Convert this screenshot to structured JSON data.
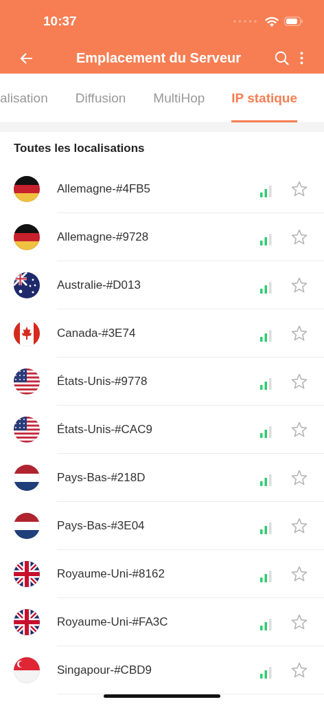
{
  "status_bar": {
    "time": "10:37"
  },
  "header": {
    "title": "Emplacement du Serveur"
  },
  "tabs": [
    {
      "label": "alisation",
      "selected": false
    },
    {
      "label": "Diffusion",
      "selected": false
    },
    {
      "label": "MultiHop",
      "selected": false
    },
    {
      "label": "IP statique",
      "selected": true
    }
  ],
  "section_title": "Toutes les localisations",
  "servers": [
    {
      "name": "Allemagne-#4FB5",
      "kind": "germany",
      "favorite": false
    },
    {
      "name": "Allemagne-#9728",
      "kind": "germany",
      "favorite": false
    },
    {
      "name": "Australie-#D013",
      "kind": "australia",
      "favorite": false
    },
    {
      "name": "Canada-#3E74",
      "kind": "canada",
      "favorite": false
    },
    {
      "name": "États-Unis-#9778",
      "kind": "usa",
      "favorite": false
    },
    {
      "name": "États-Unis-#CAC9",
      "kind": "usa",
      "favorite": false
    },
    {
      "name": "Pays-Bas-#218D",
      "kind": "netherlands",
      "favorite": false
    },
    {
      "name": "Pays-Bas-#3E04",
      "kind": "netherlands",
      "favorite": false
    },
    {
      "name": "Royaume-Uni-#8162",
      "kind": "uk",
      "favorite": false
    },
    {
      "name": "Royaume-Uni-#FA3C",
      "kind": "uk",
      "favorite": false
    },
    {
      "name": "Singapour-#CBD9",
      "kind": "singapore",
      "favorite": false
    }
  ]
}
